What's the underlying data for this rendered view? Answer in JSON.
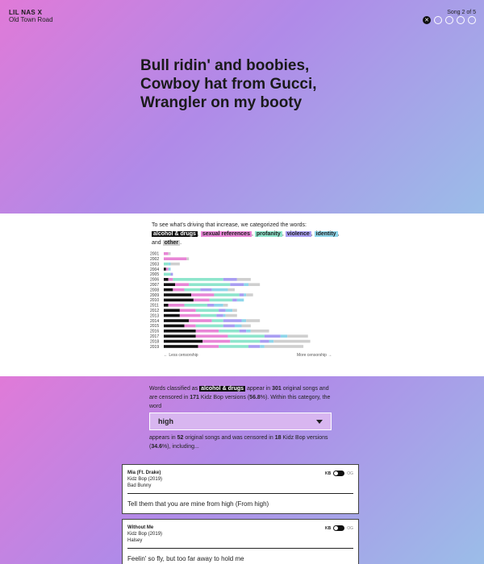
{
  "header": {
    "artist": "LIL NAS X",
    "song": "Old Town Road",
    "song_count": "Song 2 of 5",
    "close_glyph": "✕"
  },
  "hero_lyric": [
    "Bull ridin' and boobies,",
    "Cowboy hat from Gucci,",
    "Wrangler on my booty"
  ],
  "intro": {
    "text1": "To see what's driving that increase, we categorized the words:",
    "categories": [
      {
        "label": "alcohol & drugs",
        "color": "#111111"
      },
      {
        "label": "sexual references",
        "color": "#e886d6"
      },
      {
        "label": "profanity",
        "color": "#8ee5cc"
      },
      {
        "label": "violence",
        "color": "#a99ef2"
      },
      {
        "label": "identity",
        "color": "#8ed6ea"
      },
      {
        "label": "other",
        "color": "#cfcfcf"
      }
    ],
    "and_word": "and",
    "comma": ","
  },
  "chart_data": {
    "type": "bar",
    "stacked": true,
    "orientation": "horizontal",
    "categories": [
      "2001",
      "2002",
      "2003",
      "2004",
      "2005",
      "2006",
      "2007",
      "2008",
      "2009",
      "2010",
      "2011",
      "2012",
      "2013",
      "2014",
      "2015",
      "2016",
      "2017",
      "2018",
      "2019"
    ],
    "series": [
      {
        "name": "alcohol & drugs",
        "color": "#111111",
        "values": [
          0,
          0,
          0,
          1,
          0,
          2,
          5,
          4,
          12,
          13,
          2,
          7,
          7,
          11,
          9,
          14,
          14,
          17,
          15
        ]
      },
      {
        "name": "sexual references",
        "color": "#e886d6",
        "values": [
          2,
          10,
          0,
          1,
          0,
          2,
          6,
          5,
          10,
          7,
          7,
          7,
          9,
          10,
          5,
          10,
          14,
          12,
          9
        ]
      },
      {
        "name": "profanity",
        "color": "#8ee5cc",
        "values": [
          0,
          0,
          2,
          0,
          3,
          22,
          18,
          7,
          11,
          10,
          10,
          10,
          7,
          5,
          12,
          9,
          16,
          13,
          13
        ]
      },
      {
        "name": "violence",
        "color": "#a99ef2",
        "values": [
          0,
          0,
          0,
          0,
          1,
          6,
          6,
          5,
          2,
          2,
          3,
          3,
          3,
          8,
          5,
          3,
          7,
          4,
          5
        ]
      },
      {
        "name": "identity",
        "color": "#8ed6ea",
        "values": [
          0,
          0,
          1,
          1,
          0,
          0,
          2,
          7,
          1,
          3,
          4,
          3,
          1,
          2,
          3,
          2,
          3,
          2,
          2
        ]
      },
      {
        "name": "other",
        "color": "#cfcfcf",
        "values": [
          1,
          1,
          4,
          0,
          0,
          6,
          5,
          3,
          3,
          0,
          2,
          2,
          5,
          6,
          4,
          8,
          9,
          16,
          17
        ]
      }
    ],
    "xlim": [
      0,
      74
    ],
    "notes": {
      "left": "← Less censorship",
      "right": "More censorship →"
    }
  },
  "stats": {
    "p1_a": "Words classified as",
    "category": "alcohol & drugs",
    "p1_b": "appear in",
    "original_songs": "301",
    "p1_c": "original songs and are censored in",
    "kb_versions": "171",
    "p1_d": "Kidz Bop versions (",
    "percent": "56.8",
    "p1_e": "%). Within this category, the word",
    "select_value": "high",
    "p2_a": "appears in",
    "word_songs": "52",
    "p2_b": "original songs and was censored in",
    "word_kb": "18",
    "p2_c": "Kidz Bop versions (",
    "word_percent": "34.6",
    "p2_d": "%), including..."
  },
  "cards": [
    {
      "title": "Mia (Ft. Drake)",
      "album": "Kidz Bop (2019)",
      "artist": "Bad Bunny",
      "kb": "KB",
      "og": "OG",
      "lyric": "Tell them that you are mine from high (From high)"
    },
    {
      "title": "Without Me",
      "album": "Kidz Bop (2019)",
      "artist": "Halsey",
      "kb": "KB",
      "og": "OG",
      "lyric": "Feelin' so fly, but too far away to hold me"
    }
  ]
}
